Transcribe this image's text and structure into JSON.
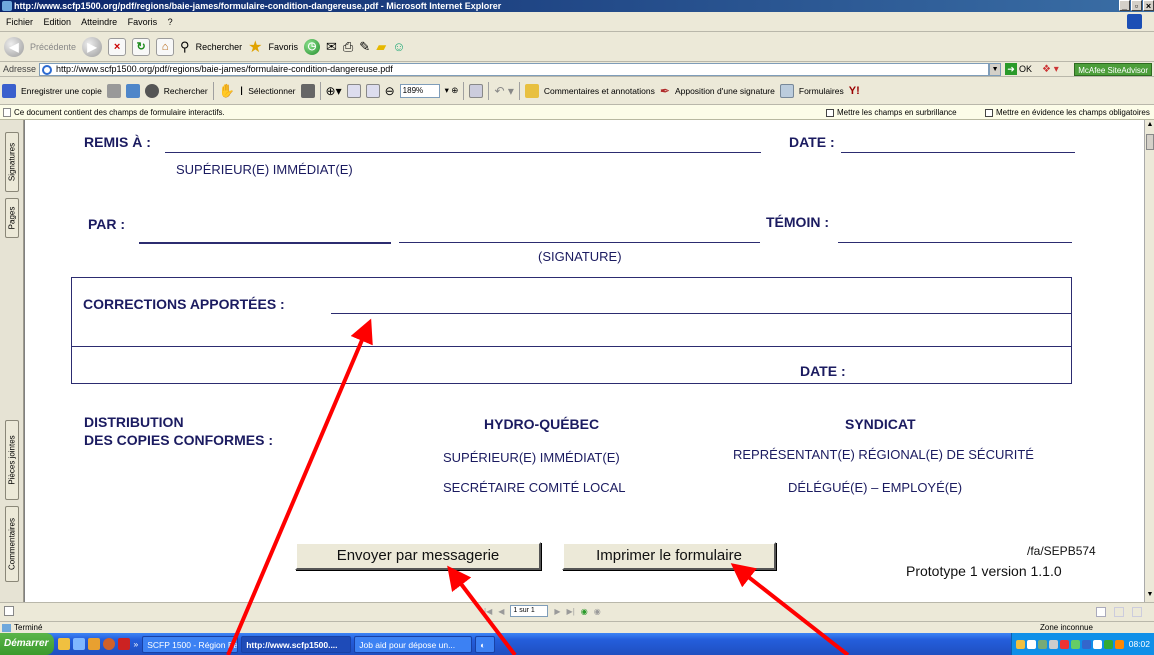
{
  "window": {
    "title": "http://www.scfp1500.org/pdf/regions/baie-james/formulaire-condition-dangereuse.pdf - Microsoft Internet Explorer",
    "controls": [
      "_",
      "▫",
      "×"
    ]
  },
  "menu": [
    "Fichier",
    "Edition",
    "Atteindre",
    "Favoris",
    "?"
  ],
  "nav": {
    "back": "Précédente",
    "search": "Rechercher",
    "favorites": "Favoris"
  },
  "address": {
    "label": "Adresse",
    "url": "http://www.scfp1500.org/pdf/regions/baie-james/formulaire-condition-dangereuse.pdf",
    "go": "OK",
    "mcafee": "McAfee SiteAdvisor"
  },
  "acrobat": {
    "save_copy": "Enregistrer une copie",
    "search": "Rechercher",
    "select": "Sélectionner",
    "zoom": "189%",
    "comments": "Commentaires et annotations",
    "signature": "Apposition d'une signature",
    "forms": "Formulaires"
  },
  "notice": {
    "text": "Ce document contient des champs de formulaire interactifs.",
    "highlight": "Mettre les champs en surbrillance",
    "required": "Mettre en évidence les champs obligatoires"
  },
  "side_tabs": [
    "Signatures",
    "Pages",
    "Pièces jointes",
    "Commentaires"
  ],
  "form": {
    "remis_a": "REMIS À :",
    "date1": "DATE :",
    "superieur": "SUPÉRIEUR(E) IMMÉDIAT(E)",
    "par": "PAR :",
    "temoin": "TÉMOIN :",
    "signature": "(SIGNATURE)",
    "corrections": "CORRECTIONS APPORTÉES :",
    "date2": "DATE :",
    "distribution_1": "DISTRIBUTION",
    "distribution_2": "DES COPIES CONFORMES :",
    "hydro": "HYDRO-QUÉBEC",
    "syndicat": "SYNDICAT",
    "hq_1": "SUPÉRIEUR(E) IMMÉDIAT(E)",
    "hq_2": "SECRÉTAIRE COMITÉ LOCAL",
    "syn_1": "REPRÉSENTANT(E) RÉGIONAL(E) DE SÉCURITÉ",
    "syn_2": "DÉLÉGUÉ(E) – EMPLOYÉ(E)",
    "send_button": "Envoyer par messagerie",
    "print_button": "Imprimer le formulaire",
    "ref": "/fa/SEPB574",
    "version": "Prototype 1 version 1.1.0"
  },
  "pager": {
    "page": "1 sur 1"
  },
  "status": {
    "left": "Terminé",
    "zone": "Zone inconnue"
  },
  "taskbar": {
    "start": "Démarrer",
    "more": "»",
    "tasks": [
      "SCFP 1500 - Région Baie ...",
      "http://www.scfp1500....",
      "Job aid pour dépose un..."
    ],
    "clock": "08:02"
  },
  "colors": {
    "form_text": "#1b1b60",
    "arrow": "#ff0000",
    "title_bar": "#0a246a",
    "taskbar": "#245edc"
  }
}
